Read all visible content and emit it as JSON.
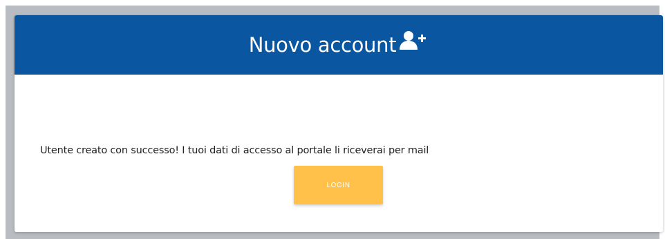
{
  "header": {
    "title": "Nuovo account",
    "icon": "user-plus-icon"
  },
  "main": {
    "message": "Utente creato con successo! I tuoi dati di accesso al portale li riceverai per mail",
    "login_label": "LOGIN"
  },
  "colors": {
    "header_background": "#0a56a0",
    "button_background": "#ffc14a",
    "text": "#222222",
    "frame": "#b9bcc1"
  }
}
